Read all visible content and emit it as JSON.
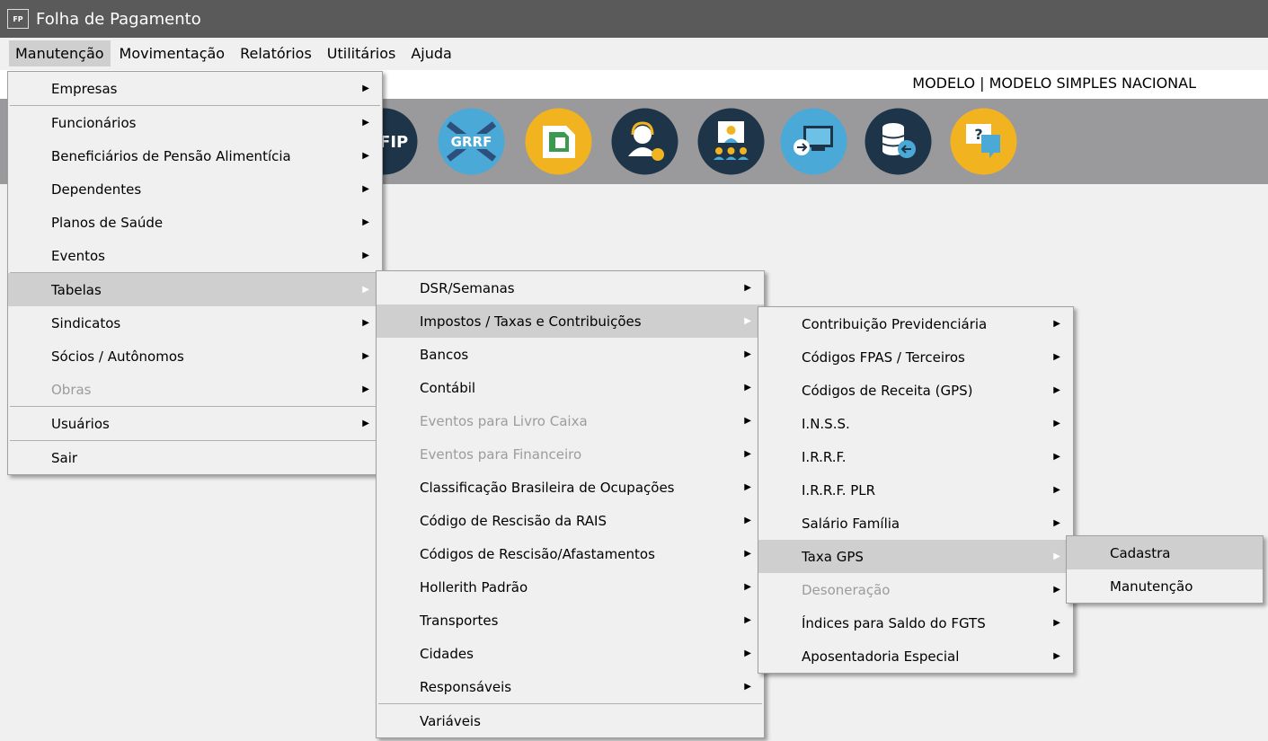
{
  "window": {
    "icon_text": "FP",
    "title": "Folha de Pagamento"
  },
  "menubar": [
    "Manutenção",
    "Movimentação",
    "Relatórios",
    "Utilitários",
    "Ajuda"
  ],
  "company": "MODELO | MODELO SIMPLES NACIONAL",
  "toolbar_icons": [
    {
      "name": "sefip-icon",
      "label": "EFIP",
      "color": "#1e3448"
    },
    {
      "name": "grrf-icon",
      "label": "GRRF",
      "color": "#4aa9d6"
    },
    {
      "name": "document-icon",
      "color": "#f2b320"
    },
    {
      "name": "support-agent-icon",
      "color": "#1e3448"
    },
    {
      "name": "meeting-icon",
      "color": "#1e3448"
    },
    {
      "name": "remote-screen-icon",
      "color": "#4aa9d6"
    },
    {
      "name": "database-backup-icon",
      "color": "#1e3448"
    },
    {
      "name": "help-chat-icon",
      "color": "#f2b320"
    }
  ],
  "menu1": {
    "items": [
      {
        "label": "Empresas",
        "arrow": true,
        "enabled": true
      },
      {
        "sep": true
      },
      {
        "label": "Funcionários",
        "arrow": true,
        "enabled": true
      },
      {
        "label": "Beneficiários de Pensão Alimentícia",
        "arrow": true,
        "enabled": true
      },
      {
        "label": "Dependentes",
        "arrow": true,
        "enabled": true
      },
      {
        "label": "Planos de Saúde",
        "arrow": true,
        "enabled": true
      },
      {
        "label": "Eventos",
        "arrow": true,
        "enabled": true
      },
      {
        "sep": true
      },
      {
        "label": "Tabelas",
        "arrow": true,
        "enabled": true,
        "highlighted": true
      },
      {
        "label": "Sindicatos",
        "arrow": true,
        "enabled": true
      },
      {
        "label": "Sócios / Autônomos",
        "arrow": true,
        "enabled": true
      },
      {
        "label": "Obras",
        "arrow": true,
        "enabled": false
      },
      {
        "sep": true
      },
      {
        "label": "Usuários",
        "arrow": true,
        "enabled": true
      },
      {
        "sep": true
      },
      {
        "label": "Sair",
        "arrow": false,
        "enabled": true
      }
    ]
  },
  "menu2": {
    "items": [
      {
        "label": "DSR/Semanas",
        "arrow": true,
        "enabled": true
      },
      {
        "label": "Impostos / Taxas e Contribuições",
        "arrow": true,
        "enabled": true,
        "highlighted": true
      },
      {
        "label": "Bancos",
        "arrow": true,
        "enabled": true
      },
      {
        "label": "Contábil",
        "arrow": true,
        "enabled": true
      },
      {
        "label": "Eventos para Livro Caixa",
        "arrow": true,
        "enabled": false
      },
      {
        "label": "Eventos para Financeiro",
        "arrow": true,
        "enabled": false
      },
      {
        "label": "Classificação Brasileira de Ocupações",
        "arrow": true,
        "enabled": true
      },
      {
        "label": "Código de Rescisão da RAIS",
        "arrow": true,
        "enabled": true
      },
      {
        "label": "Códigos de Rescisão/Afastamentos",
        "arrow": true,
        "enabled": true
      },
      {
        "label": "Hollerith Padrão",
        "arrow": true,
        "enabled": true
      },
      {
        "label": "Transportes",
        "arrow": true,
        "enabled": true
      },
      {
        "label": "Cidades",
        "arrow": true,
        "enabled": true
      },
      {
        "label": "Responsáveis",
        "arrow": true,
        "enabled": true
      },
      {
        "sep": true
      },
      {
        "label": "Variáveis",
        "arrow": false,
        "enabled": true
      }
    ]
  },
  "menu3": {
    "items": [
      {
        "label": "Contribuição Previdenciária",
        "arrow": true,
        "enabled": true
      },
      {
        "label": "Códigos FPAS / Terceiros",
        "arrow": true,
        "enabled": true
      },
      {
        "label": "Códigos de Receita (GPS)",
        "arrow": true,
        "enabled": true
      },
      {
        "label": "I.N.S.S.",
        "arrow": true,
        "enabled": true
      },
      {
        "label": "I.R.R.F.",
        "arrow": true,
        "enabled": true
      },
      {
        "label": "I.R.R.F. PLR",
        "arrow": true,
        "enabled": true
      },
      {
        "label": "Salário Família",
        "arrow": true,
        "enabled": true
      },
      {
        "label": "Taxa GPS",
        "arrow": true,
        "enabled": true,
        "highlighted": true
      },
      {
        "label": "Desoneração",
        "arrow": true,
        "enabled": false
      },
      {
        "label": "Índices para Saldo do FGTS",
        "arrow": true,
        "enabled": true
      },
      {
        "label": "Aposentadoria Especial",
        "arrow": true,
        "enabled": true
      }
    ]
  },
  "menu4": {
    "items": [
      {
        "label": "Cadastra",
        "arrow": false,
        "enabled": true,
        "highlighted": true
      },
      {
        "label": "Manutenção",
        "arrow": false,
        "enabled": true
      }
    ]
  }
}
